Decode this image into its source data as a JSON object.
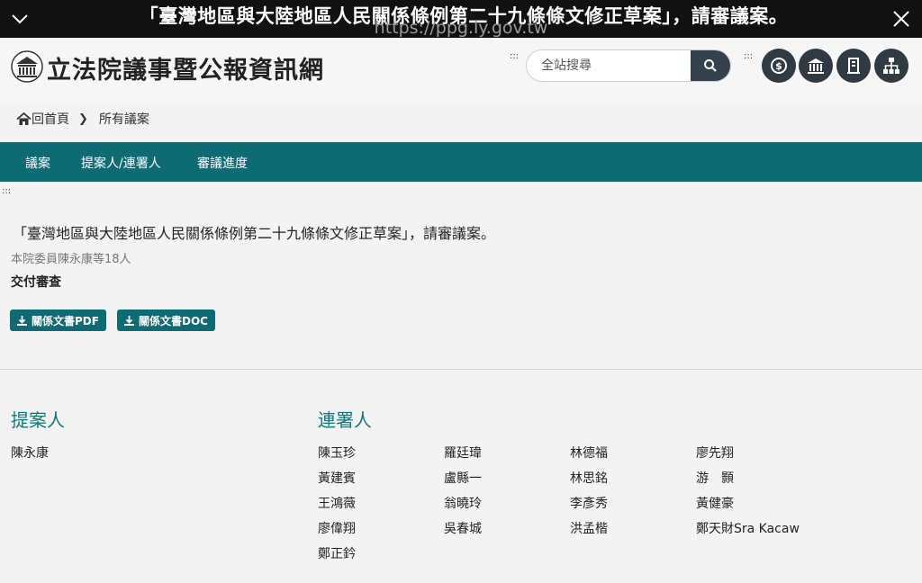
{
  "overlay": {
    "title": "「臺灣地區與大陸地區人民關係條例第二十九條條文修正草案」，請審議案。",
    "url": "https://ppg.ly.gov.tw"
  },
  "header": {
    "site_name": "立法院議事暨公報資訊網",
    "search_placeholder": "全站搜尋"
  },
  "breadcrumb": {
    "home": "回首頁",
    "current": "所有議案"
  },
  "nav": [
    "議案",
    "提案人/連署人",
    "審議進度"
  ],
  "bill": {
    "title": "「臺灣地區與大陸地區人民關係條例第二十九條條文修正草案」，請審議案。",
    "proposer_line": "本院委員陳永康等18人",
    "status": "交付審查",
    "download_pdf": "關係文書PDF",
    "download_doc": "關係文書DOC"
  },
  "proposers": {
    "heading": "提案人",
    "names": [
      "陳永康"
    ]
  },
  "cosigners": {
    "heading": "連署人",
    "columns": [
      [
        "陳玉珍",
        "黃建賓",
        "王鴻薇",
        "廖偉翔",
        "鄭正鈐"
      ],
      [
        "羅廷瑋",
        "盧縣一",
        "翁曉玲",
        "吳春城"
      ],
      [
        "林德福",
        "林思銘",
        "李彥秀",
        "洪孟楷"
      ],
      [
        "廖先翔",
        "游　顥",
        "黃健豪",
        "鄭天財Sra Kacaw"
      ]
    ]
  },
  "colors": {
    "nav_bg": "#0e6b73",
    "heading": "#11787f",
    "dark_button": "#2f3a43"
  },
  "icons": [
    "chevron-down-icon",
    "close-icon",
    "search-icon",
    "money-icon",
    "bank-icon",
    "building-icon",
    "sitemap-icon",
    "home-icon",
    "download-icon"
  ]
}
